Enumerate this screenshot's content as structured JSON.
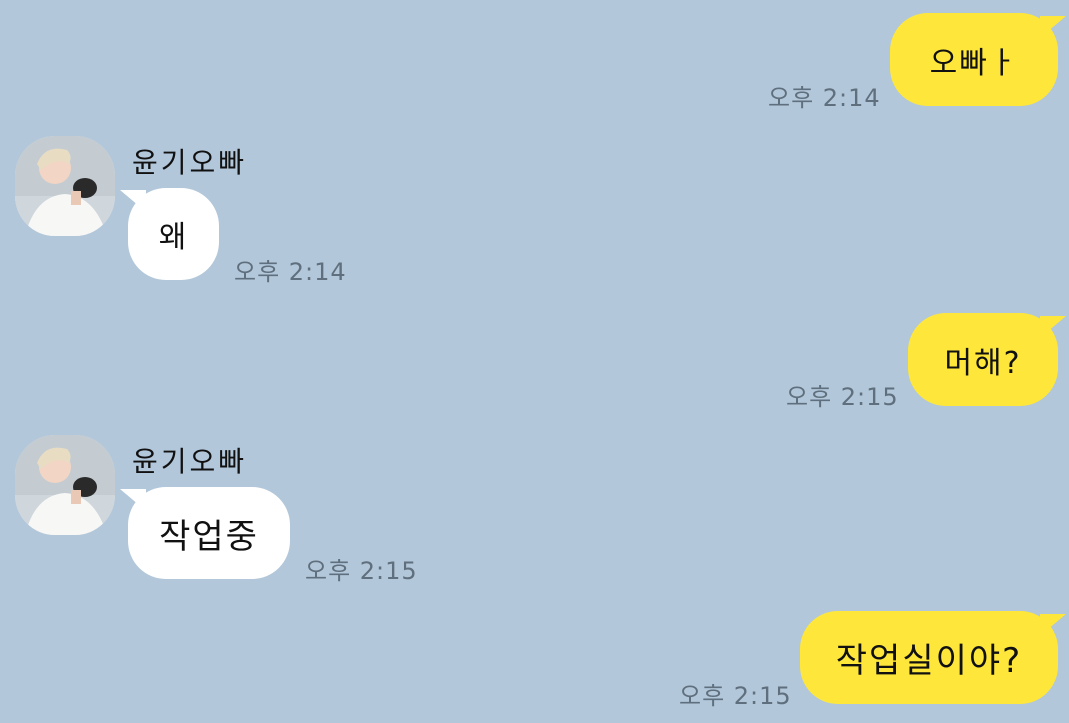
{
  "chat": {
    "contact_name": "윤기오빠",
    "messages": [
      {
        "sender": "me",
        "text": "오빠ㅏ",
        "time": "오후 2:14"
      },
      {
        "sender": "them",
        "text": "왜",
        "time": "오후 2:14"
      },
      {
        "sender": "me",
        "text": "머해?",
        "time": "오후 2:15"
      },
      {
        "sender": "them",
        "text": "작업중",
        "time": "오후 2:15"
      },
      {
        "sender": "me",
        "text": "작업실이야?",
        "time": "오후 2:15"
      }
    ]
  },
  "colors": {
    "background": "#b2c7da",
    "my_bubble": "#fee73a",
    "their_bubble": "#ffffff",
    "time_text": "#5f6f7d"
  },
  "icons": {
    "avatar": "profile-photo"
  }
}
